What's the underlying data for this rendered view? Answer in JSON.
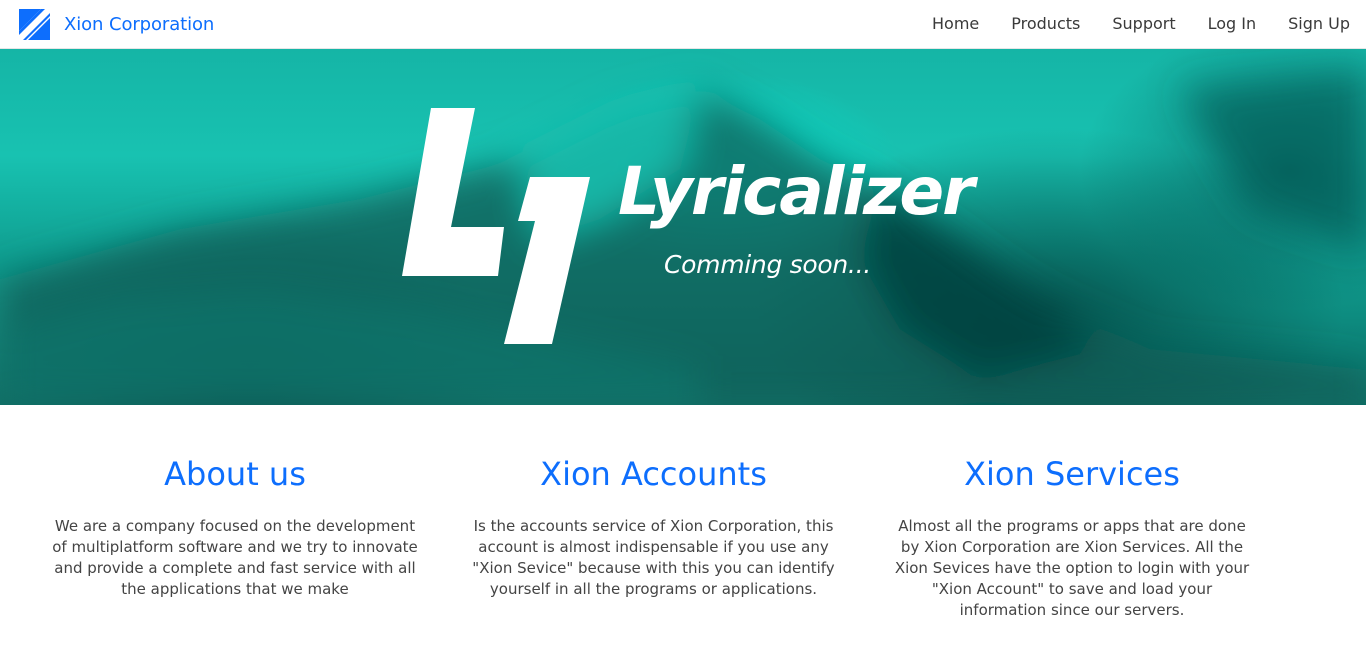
{
  "navbar": {
    "brand_name": "Xion Corporation",
    "brand_icon": "xion-logo-icon",
    "links": [
      {
        "label": "Home"
      },
      {
        "label": "Products"
      },
      {
        "label": "Support"
      },
      {
        "label": "Log In"
      },
      {
        "label": "Sign Up"
      }
    ]
  },
  "hero": {
    "logo_icon": "lyricalizer-logo-icon",
    "title": "Lyricalizer",
    "subtitle": "Comming soon..."
  },
  "features": [
    {
      "title": "About us",
      "text": "We are a company focused on the development of multiplatform software and we try to innovate and provide a complete and fast service with all the applications that we make"
    },
    {
      "title": "Xion Accounts",
      "text": "Is the accounts service of Xion Corporation, this account is almost indispensable if you use any \"Xion Sevice\" because with this you can identify yourself in all the programs or applications."
    },
    {
      "title": "Xion Services",
      "text": "Almost all the programs or apps that are done by Xion Corporation are Xion Services. All the Xion Sevices have the option to login with your \"Xion Account\" to save and load your information since our servers."
    }
  ],
  "colors": {
    "accent": "#0d6efd",
    "hero_teal": "#18c2b1",
    "nav_text": "#3a3a3a",
    "body_text": "#444444"
  }
}
